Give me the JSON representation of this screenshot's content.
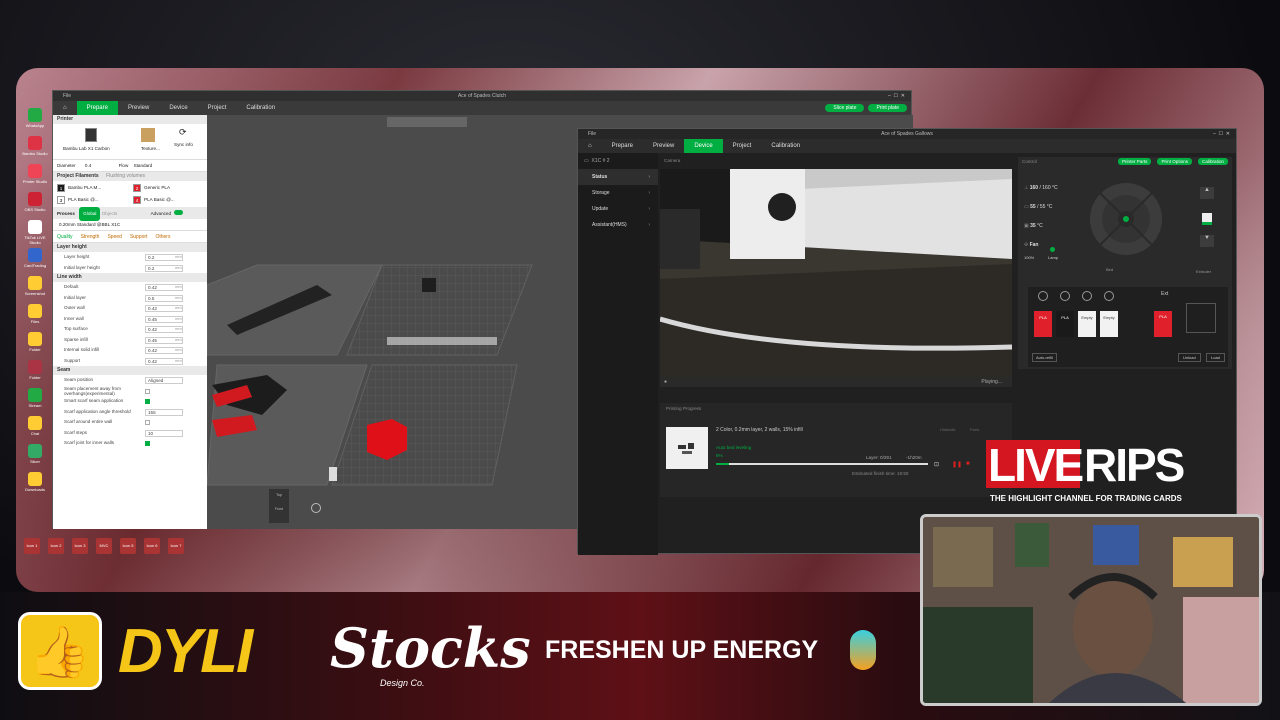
{
  "desktop_icons": [
    "WhatsApp",
    "Bambu Studio",
    "Printer Studio",
    "OBS Studio",
    "TikTok LIVE Studio",
    "CardTrading",
    "Screenshot",
    "Files",
    "Folder",
    "Folder",
    "Stream",
    "Chat",
    "Slicer",
    "Downloads"
  ],
  "taskbar_icons": [
    "Icon 1",
    "Icon 2",
    "Icon 3",
    "MVC",
    "Icon 5",
    "Icon 6",
    "Icon 7"
  ],
  "w1": {
    "title": "Ace of Spades Clutch",
    "menu": "File",
    "tabs": [
      "Prepare",
      "Preview",
      "Device",
      "Project",
      "Calibration"
    ],
    "slice_btn": "Slice plate",
    "print_btn": "Print plate",
    "sidebar": {
      "printer_header": "Printer",
      "printer_name": "Bambu Lab X1 Carbon",
      "plate_label": "Texture...",
      "sync_label": "Sync info",
      "diameter_label": "Diameter",
      "diameter_value": "0.4",
      "flow_label": "Flow",
      "flow_value": "Standard",
      "filaments_header": "Project Filaments",
      "filaments_hint": "Flushing volumes",
      "filaments": [
        {
          "num": "1",
          "name": "Bambu PLA M...",
          "color": "#1a1a1a"
        },
        {
          "num": "2",
          "name": "Generic PLA",
          "color": "#e0202a"
        },
        {
          "num": "3",
          "name": "PLA Basic @...",
          "color": "#ffffff"
        },
        {
          "num": "4",
          "name": "PLA Basic @...",
          "color": "#e0202a"
        }
      ],
      "process_label": "Process",
      "process_toggle": "Global",
      "process_objects": "Objects",
      "advanced_label": "Advanced",
      "preset": "0.20mm Standard @BBL X1C",
      "qtabs": [
        "Quality",
        "Strength",
        "Speed",
        "Support",
        "Others"
      ],
      "sections": [
        {
          "title": "Layer height",
          "rows": [
            {
              "label": "Layer height",
              "value": "0.2",
              "unit": "mm"
            },
            {
              "label": "Initial layer height",
              "value": "0.2",
              "unit": "mm"
            }
          ]
        },
        {
          "title": "Line width",
          "rows": [
            {
              "label": "Default",
              "value": "0.42",
              "unit": "mm"
            },
            {
              "label": "Initial layer",
              "value": "0.5",
              "unit": "mm"
            },
            {
              "label": "Outer wall",
              "value": "0.42",
              "unit": "mm"
            },
            {
              "label": "Inner wall",
              "value": "0.45",
              "unit": "mm"
            },
            {
              "label": "Top surface",
              "value": "0.42",
              "unit": "mm"
            },
            {
              "label": "Sparse infill",
              "value": "0.45",
              "unit": "mm"
            },
            {
              "label": "Internal solid infill",
              "value": "0.42",
              "unit": "mm"
            },
            {
              "label": "Support",
              "value": "0.42",
              "unit": "mm"
            }
          ]
        },
        {
          "title": "Seam",
          "rows": [
            {
              "label": "Seam position",
              "value": "Aligned",
              "unit": ""
            },
            {
              "label": "Seam placement away from overhangs(experimental)",
              "value": "",
              "unit": ""
            },
            {
              "label": "Smart scarf seam application",
              "value": "",
              "unit": ""
            },
            {
              "label": "Scarf application angle threshold",
              "value": "155",
              "unit": ""
            },
            {
              "label": "Scarf around entire wall",
              "value": "",
              "unit": ""
            },
            {
              "label": "Scarf steps",
              "value": "10",
              "unit": ""
            },
            {
              "label": "Scarf joint for inner walls",
              "value": "",
              "unit": ""
            }
          ]
        }
      ]
    },
    "viewport": {
      "plate_btns": [
        "Top",
        "Front"
      ]
    }
  },
  "w2": {
    "title": "Ace of Spades Gallows",
    "menu": "File",
    "tabs": [
      "Prepare",
      "Preview",
      "Device",
      "Project",
      "Calibration"
    ],
    "device_name": "X1C # 2",
    "nav": [
      "Status",
      "Storage",
      "Update",
      "Assistant(HMS)"
    ],
    "camera_label": "Camera",
    "camera_status": "Playing...",
    "control_label": "Control",
    "control_btns": [
      "Printer Parts",
      "Print Options",
      "Calibration"
    ],
    "nozzle_temp": "160",
    "nozzle_target": "160",
    "bed_temp": "55",
    "bed_target": "55",
    "chamber_temp": "35",
    "fan_label": "Fan",
    "fan_speed": "100%",
    "lamp_label": "Lamp",
    "bed_label": "Bed",
    "extruder_label": "Extruder",
    "ams_slots": [
      {
        "label": "PLA",
        "color": "#e0202a"
      },
      {
        "label": "PLA",
        "color": "#1a1a1a"
      },
      {
        "label": "Empty",
        "color": "#f2f2f2"
      },
      {
        "label": "Empty",
        "color": "#f2f2f2"
      }
    ],
    "ext_label": "Ext",
    "ext_slot": "PLA",
    "auto_refill": "Auto-refill",
    "unload_btn": "Unload",
    "load_btn": "Load",
    "printing_label": "Printing Progress",
    "job_desc": "2 Color, 0.2mm layer, 2 walls, 15% infill",
    "stage": "Auto bed leveling",
    "progress_pct": "6%",
    "progress": 0.06,
    "layer": "Layer: 0/291",
    "time_left": "-1h20m",
    "finish": "Estimated finish time: 19:50",
    "hms": "Hidetails",
    "parts": "Parts"
  },
  "overlay": {
    "live": "LIVE",
    "rips": "RIPS",
    "tagline": "THE HIGHLIGHT CHANNEL FOR TRADING CARDS",
    "sponsor1": "DYLI",
    "sponsor2": "Stocks",
    "sponsor2_sub": "Design Co.",
    "sponsor3": "FRESHEN UP ENERGY"
  }
}
